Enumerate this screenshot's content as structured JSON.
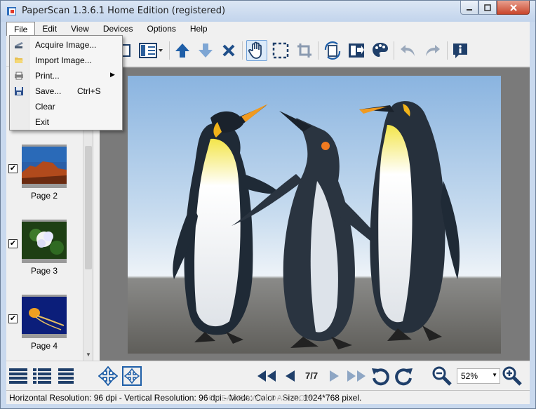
{
  "window": {
    "title": "PaperScan 1.3.6.1 Home Edition (registered)"
  },
  "menubar": {
    "items": [
      {
        "label": "File"
      },
      {
        "label": "Edit"
      },
      {
        "label": "View"
      },
      {
        "label": "Devices"
      },
      {
        "label": "Options"
      },
      {
        "label": "Help"
      }
    ]
  },
  "file_menu": {
    "items": [
      {
        "label": "Acquire Image...",
        "icon": "scanner-icon",
        "shortcut": ""
      },
      {
        "label": "Import Image...",
        "icon": "folder-open-icon",
        "shortcut": ""
      },
      {
        "label": "Print...",
        "icon": "printer-icon",
        "shortcut": "",
        "submenu": "▶"
      },
      {
        "label": "Save...",
        "icon": "floppy-disk-icon",
        "shortcut": "Ctrl+S"
      },
      {
        "label": "Clear",
        "icon": "",
        "shortcut": ""
      },
      {
        "label": "Exit",
        "icon": "",
        "shortcut": ""
      }
    ]
  },
  "toolbar": {
    "icons": [
      "copy-page-icon",
      "page-layout-icon",
      "move-up-icon",
      "move-down-icon",
      "delete-icon",
      "pan-hand-icon",
      "select-rectangle-icon",
      "crop-icon",
      "rotate-icon",
      "flip-icon",
      "color-palette-icon",
      "undo-icon",
      "redo-icon",
      "info-icon"
    ]
  },
  "thumbnails": [
    {
      "label": "Page 2",
      "checked": true
    },
    {
      "label": "Page 3",
      "checked": true
    },
    {
      "label": "Page 4",
      "checked": true
    }
  ],
  "navigation": {
    "page_indicator": "7/7",
    "zoom": "52%"
  },
  "statusbar": {
    "text": "Horizontal Resolution:  96 dpi - Vertical Resolution:  96 dpi - Mode: Color - Size: 1024*768 pixel."
  },
  "watermark": "CHEATDOWNLOAD.COM",
  "colors": {
    "accent_blue": "#1f5fa8",
    "viewer_bg": "#7a7a7a",
    "menu_bg": "#f5f5f5"
  }
}
